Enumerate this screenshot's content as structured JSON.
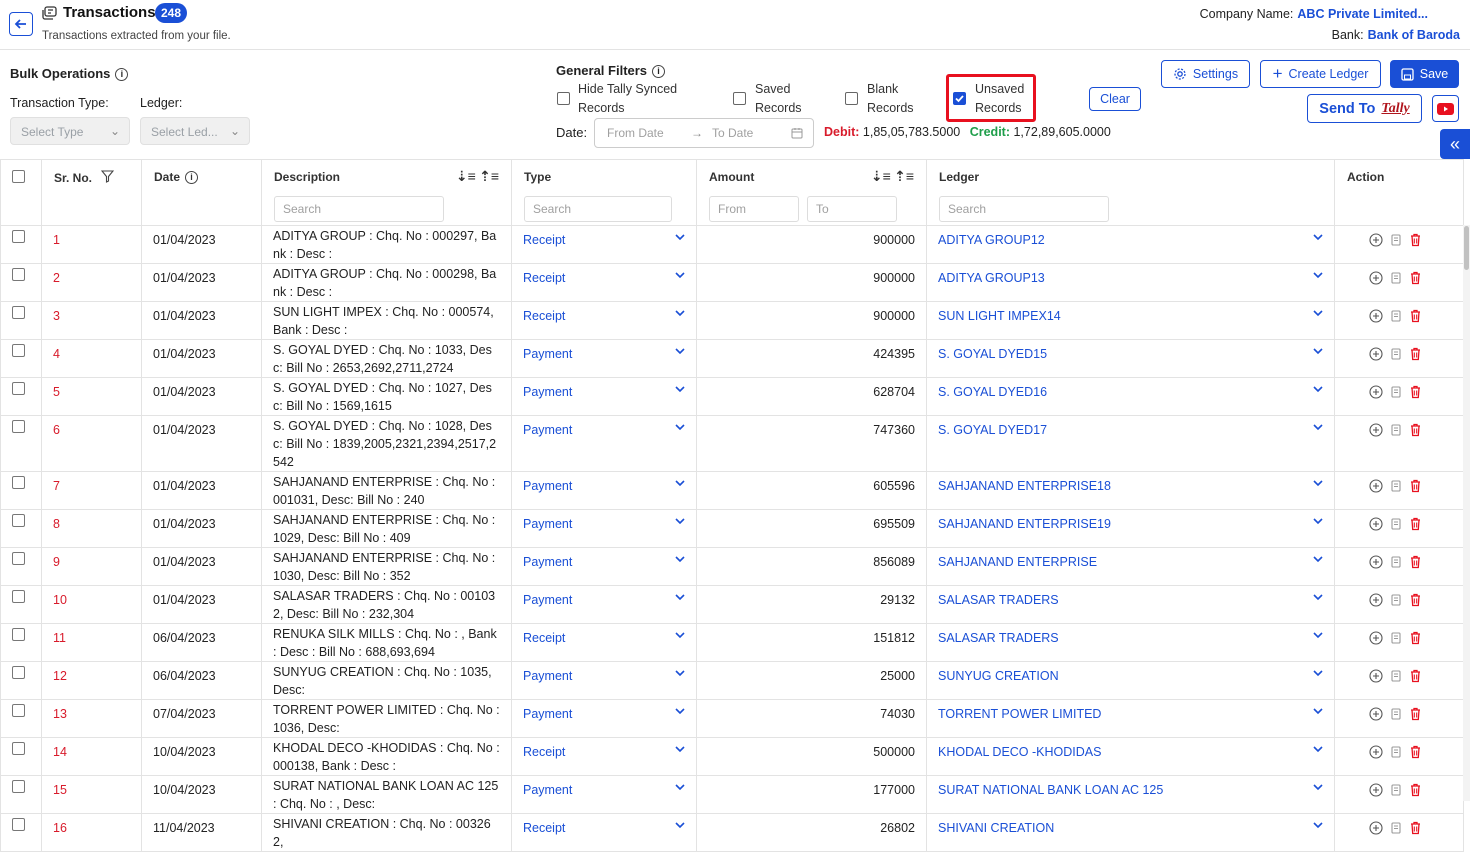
{
  "header": {
    "title": "Transactions",
    "count": "248",
    "subtitle": "Transactions extracted from your file.",
    "company_label": "Company Name:",
    "company_value": "ABC Private Limited...",
    "bank_label": "Bank:",
    "bank_value": "Bank of Baroda"
  },
  "bulk": {
    "title": "Bulk Operations",
    "type_label": "Transaction Type:",
    "ledger_label": "Ledger:",
    "type_placeholder": "Select Type",
    "ledger_placeholder": "Select Led..."
  },
  "filters": {
    "title": "General Filters",
    "hide_tally_1": "Hide Tally Synced",
    "hide_tally_2": "Records",
    "saved_1": "Saved",
    "saved_2": "Records",
    "blank_1": "Blank",
    "blank_2": "Records",
    "unsaved_1": "Unsaved",
    "unsaved_2": "Records",
    "clear": "Clear",
    "date_label": "Date:",
    "from_date": "From Date",
    "to_date": "To Date",
    "debit_label": "Debit:",
    "debit_value": "1,85,05,783.5000",
    "credit_label": "Credit:",
    "credit_value": "1,72,89,605.0000"
  },
  "toolbar": {
    "settings": "Settings",
    "create_ledger": "Create Ledger",
    "save": "Save",
    "send_to": "Send To",
    "tally_logo": "Tally"
  },
  "table": {
    "headers": {
      "sr": "Sr. No.",
      "date": "Date",
      "description": "Description",
      "type": "Type",
      "amount": "Amount",
      "ledger": "Ledger",
      "action": "Action"
    },
    "search_placeholder": "Search",
    "from_placeholder": "From",
    "to_placeholder": "To",
    "rows": [
      {
        "sr": "1",
        "date": "01/04/2023",
        "desc": "ADITYA GROUP : Chq. No : 000297, Bank : Desc :",
        "type": "Receipt",
        "amount": "900000",
        "ledger": "ADITYA GROUP12"
      },
      {
        "sr": "2",
        "date": "01/04/2023",
        "desc": "ADITYA GROUP : Chq. No : 000298, Bank : Desc :",
        "type": "Receipt",
        "amount": "900000",
        "ledger": "ADITYA GROUP13"
      },
      {
        "sr": "3",
        "date": "01/04/2023",
        "desc": "SUN LIGHT IMPEX : Chq. No : 000574, Bank : Desc :",
        "type": "Receipt",
        "amount": "900000",
        "ledger": "SUN LIGHT IMPEX14"
      },
      {
        "sr": "4",
        "date": "01/04/2023",
        "desc": "S. GOYAL DYED : Chq. No : 1033, Desc: Bill No : 2653,2692,2711,2724",
        "type": "Payment",
        "amount": "424395",
        "ledger": "S. GOYAL DYED15"
      },
      {
        "sr": "5",
        "date": "01/04/2023",
        "desc": "S. GOYAL DYED : Chq. No : 1027, Desc: Bill No : 1569,1615",
        "type": "Payment",
        "amount": "628704",
        "ledger": "S. GOYAL DYED16"
      },
      {
        "sr": "6",
        "date": "01/04/2023",
        "desc": "S. GOYAL DYED : Chq. No : 1028, Desc: Bill No : 1839,2005,2321,2394,2517,2542",
        "type": "Payment",
        "amount": "747360",
        "ledger": "S. GOYAL DYED17"
      },
      {
        "sr": "7",
        "date": "01/04/2023",
        "desc": "SAHJANAND ENTERPRISE : Chq. No : 001031, Desc: Bill No : 240",
        "type": "Payment",
        "amount": "605596",
        "ledger": "SAHJANAND ENTERPRISE18"
      },
      {
        "sr": "8",
        "date": "01/04/2023",
        "desc": "SAHJANAND ENTERPRISE : Chq. No : 1029, Desc: Bill No : 409",
        "type": "Payment",
        "amount": "695509",
        "ledger": "SAHJANAND ENTERPRISE19"
      },
      {
        "sr": "9",
        "date": "01/04/2023",
        "desc": "SAHJANAND ENTERPRISE : Chq. No : 1030, Desc: Bill No : 352",
        "type": "Payment",
        "amount": "856089",
        "ledger": "SAHJANAND ENTERPRISE"
      },
      {
        "sr": "10",
        "date": "01/04/2023",
        "desc": "SALASAR TRADERS : Chq. No : 001032, Desc: Bill No : 232,304",
        "type": "Payment",
        "amount": "29132",
        "ledger": "SALASAR TRADERS"
      },
      {
        "sr": "11",
        "date": "06/04/2023",
        "desc": "RENUKA SILK MILLS : Chq. No : , Bank : Desc : Bill No : 688,693,694",
        "type": "Receipt",
        "amount": "151812",
        "ledger": "SALASAR TRADERS"
      },
      {
        "sr": "12",
        "date": "06/04/2023",
        "desc": "SUNYUG CREATION : Chq. No : 1035, Desc:",
        "type": "Payment",
        "amount": "25000",
        "ledger": "SUNYUG CREATION"
      },
      {
        "sr": "13",
        "date": "07/04/2023",
        "desc": "TORRENT POWER LIMITED : Chq. No : 1036, Desc:",
        "type": "Payment",
        "amount": "74030",
        "ledger": "TORRENT POWER LIMITED"
      },
      {
        "sr": "14",
        "date": "10/04/2023",
        "desc": "KHODAL DECO -KHODIDAS : Chq. No : 000138, Bank : Desc :",
        "type": "Receipt",
        "amount": "500000",
        "ledger": "KHODAL DECO -KHODIDAS"
      },
      {
        "sr": "15",
        "date": "10/04/2023",
        "desc": "SURAT NATIONAL BANK LOAN AC 125 : Chq. No : , Desc:",
        "type": "Payment",
        "amount": "177000",
        "ledger": "SURAT NATIONAL BANK LOAN AC 125"
      },
      {
        "sr": "16",
        "date": "11/04/2023",
        "desc": "SHIVANI CREATION : Chq. No : 003262,",
        "type": "Receipt",
        "amount": "26802",
        "ledger": "SHIVANI CREATION"
      }
    ]
  },
  "colors": {
    "accent": "#1a4fd6",
    "serial": "#d81b2b",
    "debit": "#d81b2b",
    "credit": "#1e9e4a",
    "highlight": "#e8101f"
  }
}
